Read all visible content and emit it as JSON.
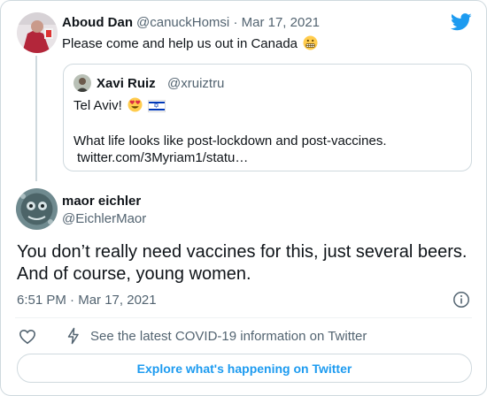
{
  "reply_to": {
    "name": "Aboud Dan",
    "handle": "@canuckHomsi",
    "separator": "·",
    "date": "Mar 17, 2021",
    "text": "Please come and help us out in Canada",
    "emoji": "grimacing-face"
  },
  "quoted": {
    "name": "Xavi Ruiz",
    "handle": "@xruiztru",
    "line1": "Tel Aviv!",
    "line2": "What life looks like post-lockdown and post-vaccines.",
    "line3": "twitter.com/3Myriam1/statu…"
  },
  "tweet": {
    "name": "maor eichler",
    "handle": "@EichlerMaor",
    "text": "You don’t really need vaccines for this, just several beers. And of course, young women.",
    "time": "6:51 PM",
    "separator": "·",
    "date": "Mar 17, 2021"
  },
  "actions": {
    "covid_info": "See the latest COVID-19 information on Twitter"
  },
  "cta": {
    "label": "Explore what's happening on Twitter"
  },
  "colors": {
    "brand": "#1d9bf0",
    "text": "#0f1419",
    "muted": "#536471",
    "border": "#cfd9de"
  },
  "icons": [
    "twitter-bird-icon",
    "info-icon",
    "heart-icon",
    "bolt-icon",
    "grimacing-face-icon",
    "heart-eyes-icon",
    "israel-flag-icon"
  ]
}
